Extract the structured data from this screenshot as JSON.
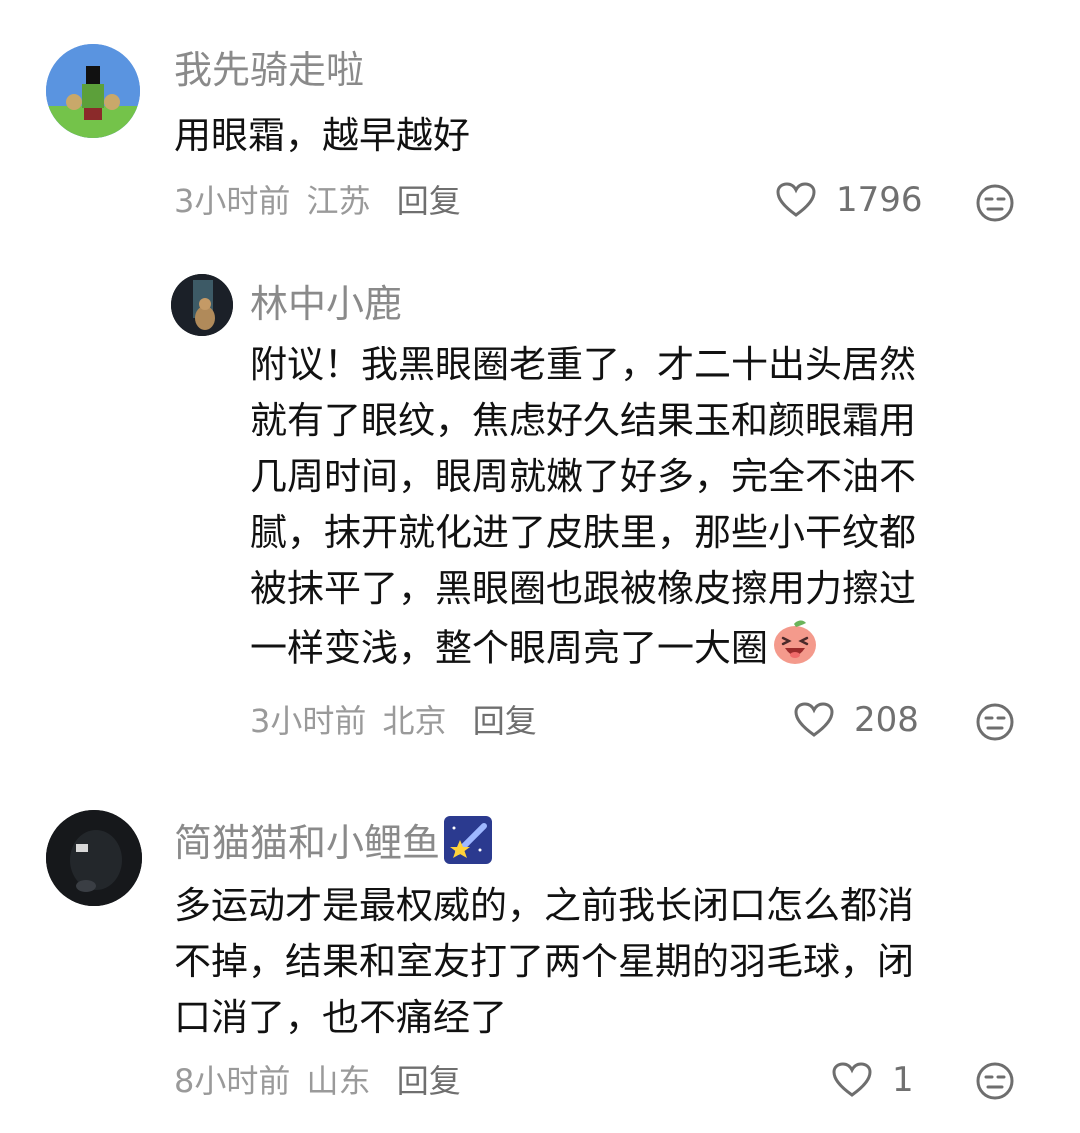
{
  "comments": [
    {
      "username": "我先骑走啦",
      "avatar": "cartoon-character-avatar",
      "text": "用眼霜，越早越好",
      "time": "3小时前",
      "location": "江苏",
      "reply_label": "回复",
      "likes": "1796"
    },
    {
      "username": "林中小鹿",
      "avatar": "cat-photo-avatar",
      "text_lines": [
        "附议！我黑眼圈老重了，才二十出头居然",
        "就有了眼纹，焦虑好久结果玉和颜眼霜用",
        "几周时间，眼周就嫩了好多，完全不油不",
        "腻，抹开就化进了皮肤里，那些小干纹都",
        "被抹平了，黑眼圈也跟被橡皮擦用力擦过",
        "一样变浅，整个眼周亮了一大圈"
      ],
      "emoji": "laughing-peach-emoji",
      "time": "3小时前",
      "location": "北京",
      "reply_label": "回复",
      "likes": "208"
    },
    {
      "username": "简猫猫和小鲤鱼",
      "username_emoji": "shooting-star-emoji",
      "avatar": "dark-photo-avatar",
      "text_lines": [
        "多运动才是最权威的，之前我长闭口怎么都消",
        "不掉，结果和室友打了两个星期的羽毛球，闭",
        "口消了，也不痛经了"
      ],
      "time": "8小时前",
      "location": "山东",
      "reply_label": "回复",
      "likes": "1"
    }
  ],
  "colors": {
    "username": "#8a8a8a",
    "meta": "#9a9a9a",
    "text": "#111111",
    "icon": "#6e6e6e"
  }
}
